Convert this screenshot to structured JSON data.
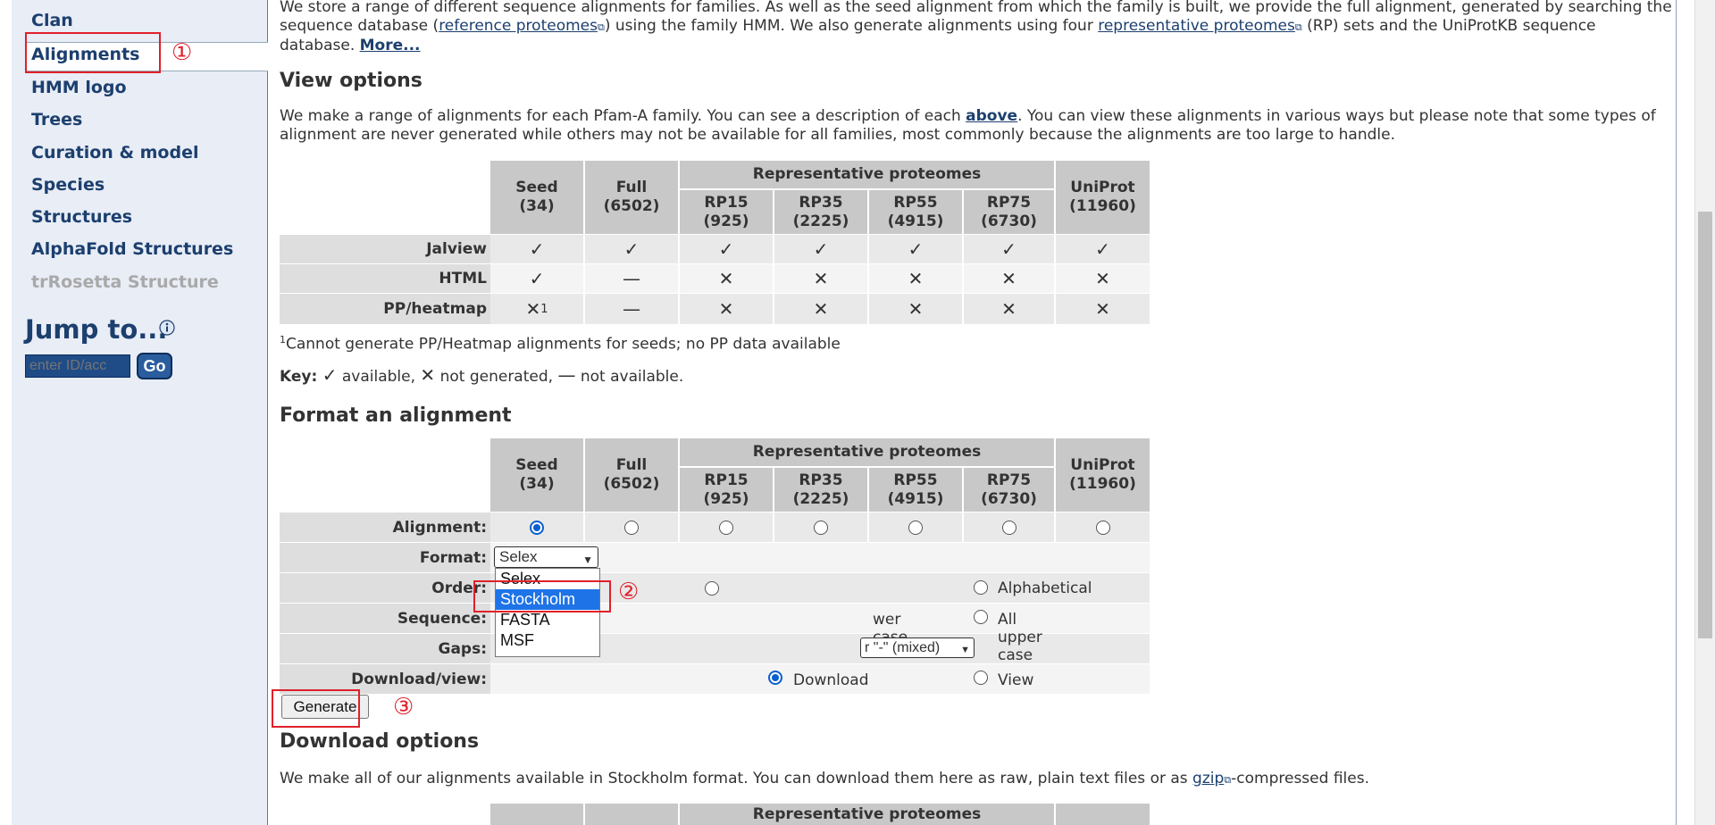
{
  "sidebar": {
    "items": [
      {
        "label": "Clan"
      },
      {
        "label": "Alignments"
      },
      {
        "label": "HMM logo"
      },
      {
        "label": "Trees"
      },
      {
        "label": "Curation & model"
      },
      {
        "label": "Species"
      },
      {
        "label": "Structures"
      },
      {
        "label": "AlphaFold Structures"
      },
      {
        "label": "trRosetta Structure"
      }
    ],
    "jump_title": "Jump to...",
    "jump_placeholder": "enter ID/acc",
    "go_label": "Go"
  },
  "annotations": {
    "one": "①",
    "two": "②",
    "three": "③"
  },
  "intro": {
    "t1": "We store a range of different sequence alignments for families. As well as the seed alignment from which the family is built, we provide the full alignment, generated by searching the sequence database (",
    "link1": "reference proteomes",
    "t2": ") using the family HMM. We also generate alignments using four ",
    "link2": "representative proteomes",
    "t3": " (RP) sets and the UniProtKB sequence database. ",
    "more": "More..."
  },
  "view_options": {
    "title": "View options",
    "t1": "We make a range of alignments for each Pfam-A family. You can see a description of each ",
    "above": "above",
    "t2": ". You can view these alignments in various ways but please note that some types of alignment are never generated while others may not be available for all families, most commonly because the alignments are too large to handle.",
    "footnote_sup": "1",
    "footnote": "Cannot generate PP/Heatmap alignments for seeds; no PP data available",
    "key_label": "Key:",
    "key_available": "available,",
    "key_not_generated": "not generated,",
    "key_not_available": "not available.",
    "rows": [
      {
        "label": "Jalview",
        "cells": [
          "check",
          "check",
          "check",
          "check",
          "check",
          "check",
          "check"
        ]
      },
      {
        "label": "HTML",
        "cells": [
          "check",
          "dash",
          "cross",
          "cross",
          "cross",
          "cross",
          "cross"
        ]
      },
      {
        "label": "PP/heatmap",
        "cells": [
          "cross1",
          "dash",
          "cross",
          "cross",
          "cross",
          "cross",
          "cross"
        ]
      }
    ]
  },
  "table_header": {
    "seed": "Seed",
    "seed_n": "(34)",
    "full": "Full",
    "full_n": "(6502)",
    "rep": "Representative proteomes",
    "rp15": "RP15",
    "rp15_n": "(925)",
    "rp35": "RP35",
    "rp35_n": "(2225)",
    "rp55": "RP55",
    "rp55_n": "(4915)",
    "rp75": "RP75",
    "rp75_n": "(6730)",
    "uniprot": "UniProt",
    "uniprot_n": "(11960)"
  },
  "format_alignment": {
    "title": "Format an alignment",
    "row_alignment": "Alignment:",
    "row_format": "Format:",
    "row_order": "Order:",
    "row_sequence": "Sequence:",
    "row_gaps": "Gaps:",
    "row_download": "Download/view:",
    "format_selected": "Selex",
    "format_options": [
      "Selex",
      "Stockholm",
      "FASTA",
      "MSF"
    ],
    "order_alpha": "Alphabetical",
    "seq_lower": "wer case",
    "seq_upper": "All upper case",
    "gaps_value": "r \"-\" (mixed)",
    "download": "Download",
    "view": "View",
    "generate": "Generate"
  },
  "download_options": {
    "title": "Download options",
    "t1": "We make all of our alignments available in Stockholm format. You can download them here as raw, plain text files or as ",
    "gzip": "gzip",
    "t2": "-compressed files.",
    "rep": "Representative proteomes"
  },
  "icons": {
    "external": "external-link-icon",
    "info": "info-icon"
  },
  "colors": {
    "annotation": "#e0202a",
    "link": "#1c3f6e",
    "selected_option": "#1e73e6"
  }
}
